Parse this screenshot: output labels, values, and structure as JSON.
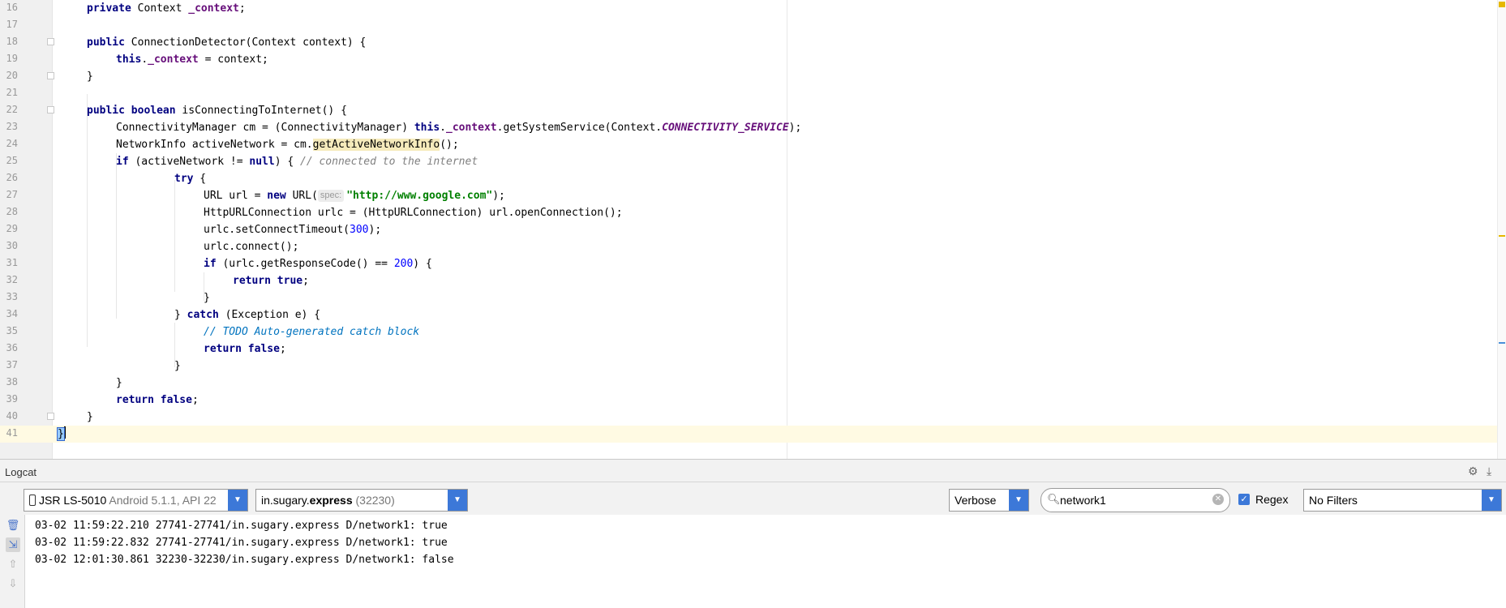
{
  "editor": {
    "line_numbers": [
      "16",
      "17",
      "18",
      "19",
      "20",
      "21",
      "22",
      "23",
      "24",
      "25",
      "26",
      "27",
      "28",
      "29",
      "30",
      "31",
      "32",
      "33",
      "34",
      "35",
      "36",
      "37",
      "38",
      "39",
      "40",
      "41"
    ],
    "code": {
      "l16_kw": "private",
      "l16_type": " Context ",
      "l16_field": "_context",
      "l16_end": ";",
      "l18_kw": "public",
      "l18_rest": " ConnectionDetector(Context context) {",
      "l19_this": "this",
      "l19_dot": ".",
      "l19_field": "_context",
      "l19_rest": " = context;",
      "l20": "}",
      "l22_kw1": "public",
      "l22_kw2": "boolean",
      "l22_rest": " isConnectingToInternet() {",
      "l23_a": "ConnectivityManager cm = (ConnectivityManager) ",
      "l23_this": "this",
      "l23_dot": ".",
      "l23_field": "_context",
      "l23_b": ".getSystemService(Context.",
      "l23_const": "CONNECTIVITY_SERVICE",
      "l23_c": ");",
      "l24_a": "NetworkInfo activeNetwork = cm.",
      "l24_warn": "getActiveNetworkInfo",
      "l24_b": "();",
      "l25_kw": "if",
      "l25_a": " (activeNetwork != ",
      "l25_null": "null",
      "l25_b": ") { ",
      "l25_comment": "// connected to the internet",
      "l26_kw": "try",
      "l26_rest": " {",
      "l27_a": "URL url = ",
      "l27_new": "new",
      "l27_b": " URL(",
      "l27_hint": "spec:",
      "l27_str": "\"http://www.google.com\"",
      "l27_c": ");",
      "l28": "HttpURLConnection urlc = (HttpURLConnection) url.openConnection();",
      "l29_a": "urlc.setConnectTimeout(",
      "l29_num": "300",
      "l29_b": ");",
      "l30": "urlc.connect();",
      "l31_kw": "if",
      "l31_a": " (urlc.getResponseCode() == ",
      "l31_num": "200",
      "l31_b": ") {",
      "l32_kw": "return",
      "l32_val": "true",
      "l32_end": ";",
      "l33": "}",
      "l34_a": "} ",
      "l34_kw": "catch",
      "l34_b": " (Exception e) {",
      "l35_slash": "// ",
      "l35_todo": "TODO Auto-generated catch block",
      "l36_kw": "return",
      "l36_val": "false",
      "l36_end": ";",
      "l37": "}",
      "l38": "}",
      "l39_kw": "return",
      "l39_val": "false",
      "l39_end": ";",
      "l40": "}",
      "l41": "}"
    }
  },
  "logcat": {
    "title": "Logcat",
    "device": {
      "name": "JSR LS-5010",
      "detail": "Android 5.1.1, API 22"
    },
    "process": {
      "prefix": "in.sugary.",
      "bold": "express",
      "pid": "(32230)"
    },
    "level": "Verbose",
    "search": {
      "value": "network1"
    },
    "regex": {
      "label": "Regex",
      "checked": true
    },
    "filter": "No Filters",
    "lines": [
      "03-02 11:59:22.210 27741-27741/in.sugary.express D/network1: true",
      "03-02 11:59:22.832 27741-27741/in.sugary.express D/network1: true",
      "03-02 12:01:30.861 32230-32230/in.sugary.express D/network1: false"
    ],
    "icons": [
      "settings-icon",
      "hide-icon",
      "clear-logcat-icon",
      "scroll-to-end-icon",
      "up-arrow-icon",
      "down-arrow-icon"
    ]
  },
  "colors": {
    "keyword": "#000080",
    "field": "#660e7a",
    "string": "#008000",
    "number": "#0000ff",
    "comment": "#808080",
    "todo": "#0073bf",
    "current_line": "#fffae3",
    "accent": "#3c78d8"
  }
}
